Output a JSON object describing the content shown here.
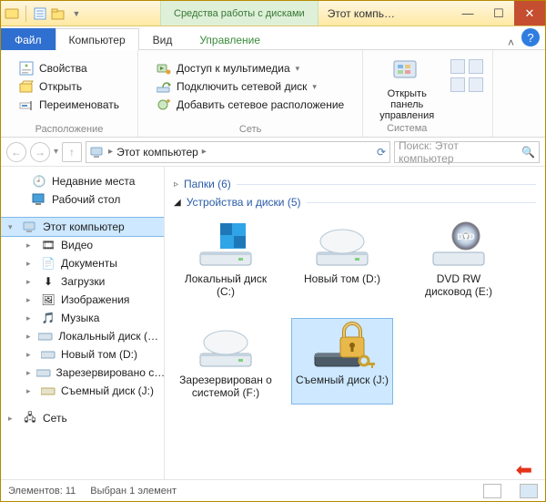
{
  "titlebar": {
    "contextual_label": "Средства работы с дисками",
    "window_title": "Этот компь…"
  },
  "tabs": {
    "file": "Файл",
    "computer": "Компьютер",
    "view": "Вид",
    "manage": "Управление"
  },
  "ribbon": {
    "location_group": "Расположение",
    "network_group": "Сеть",
    "system_group": "Система",
    "properties": "Свойства",
    "open": "Открыть",
    "rename": "Переименовать",
    "media_access": "Доступ к мультимедиа",
    "map_drive": "Подключить сетевой диск",
    "add_net_location": "Добавить сетевое расположение",
    "control_panel": "Открыть панель управления"
  },
  "address": {
    "location": "Этот компьютер",
    "search_placeholder": "Поиск: Этот компьютер"
  },
  "nav": {
    "recent": "Недавние места",
    "desktop": "Рабочий стол",
    "this_pc": "Этот компьютер",
    "videos": "Видео",
    "documents": "Документы",
    "downloads": "Загрузки",
    "pictures": "Изображения",
    "music": "Музыка",
    "local_c": "Локальный диск (…",
    "new_vol_d": "Новый том (D:)",
    "reserved": "Зарезервировано с…",
    "removable_j": "Съемный диск (J:)",
    "network": "Сеть"
  },
  "content": {
    "folders_header": "Папки (6)",
    "devices_header": "Устройства и диски (5)",
    "drives": [
      {
        "label": "Локальный диск (C:)",
        "kind": "local"
      },
      {
        "label": "Новый том (D:)",
        "kind": "local"
      },
      {
        "label": "DVD RW дисковод (E:)",
        "kind": "dvd"
      },
      {
        "label": "Зарезервирован о системой (F:)",
        "kind": "local"
      },
      {
        "label": "Съемный диск (J:)",
        "kind": "removable-locked"
      }
    ]
  },
  "status": {
    "elements": "Элементов: 11",
    "selected": "Выбран 1 элемент"
  }
}
